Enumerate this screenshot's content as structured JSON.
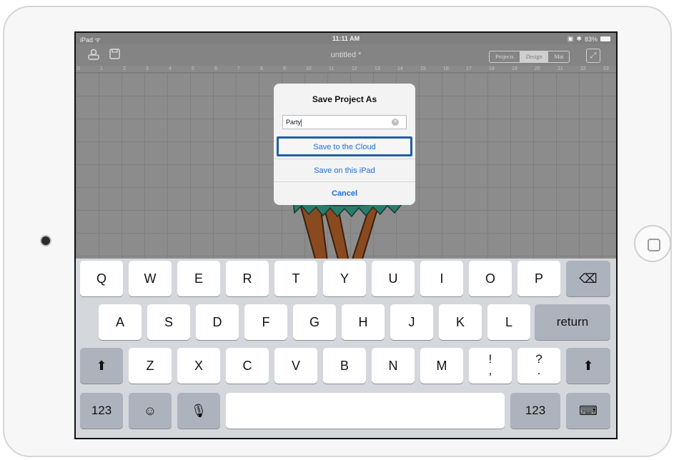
{
  "status_bar": {
    "device": "iPad",
    "time": "11:11 AM",
    "battery": "83%"
  },
  "toolbar": {
    "title": "untitled *",
    "segments": [
      "Projects",
      "Design",
      "Mat"
    ],
    "active_segment": "Design"
  },
  "ruler": {
    "marks": [
      "0",
      "1",
      "2",
      "3",
      "4",
      "5",
      "6",
      "7",
      "8",
      "9",
      "10",
      "11",
      "12",
      "13",
      "14",
      "15",
      "16",
      "17",
      "18",
      "19",
      "20",
      "21",
      "22",
      "23"
    ]
  },
  "dialog": {
    "title": "Save Project As",
    "input_value": "Party",
    "save_cloud": "Save to the Cloud",
    "save_ipad": "Save on this iPad",
    "cancel": "Cancel"
  },
  "keyboard": {
    "row1": [
      "Q",
      "W",
      "E",
      "R",
      "T",
      "Y",
      "U",
      "I",
      "O",
      "P"
    ],
    "row2": [
      "A",
      "S",
      "D",
      "F",
      "G",
      "H",
      "J",
      "K",
      "L"
    ],
    "row3": [
      "Z",
      "X",
      "C",
      "V",
      "B",
      "N",
      "M"
    ],
    "punct1": "!",
    "punct1_sub": ",",
    "punct2": "?",
    "punct2_sub": ".",
    "return": "return",
    "numbers": "123",
    "numbers_right": "123",
    "space": ""
  },
  "colors": {
    "accent": "#1f6fe0",
    "highlight_border": "#1f5faa"
  }
}
